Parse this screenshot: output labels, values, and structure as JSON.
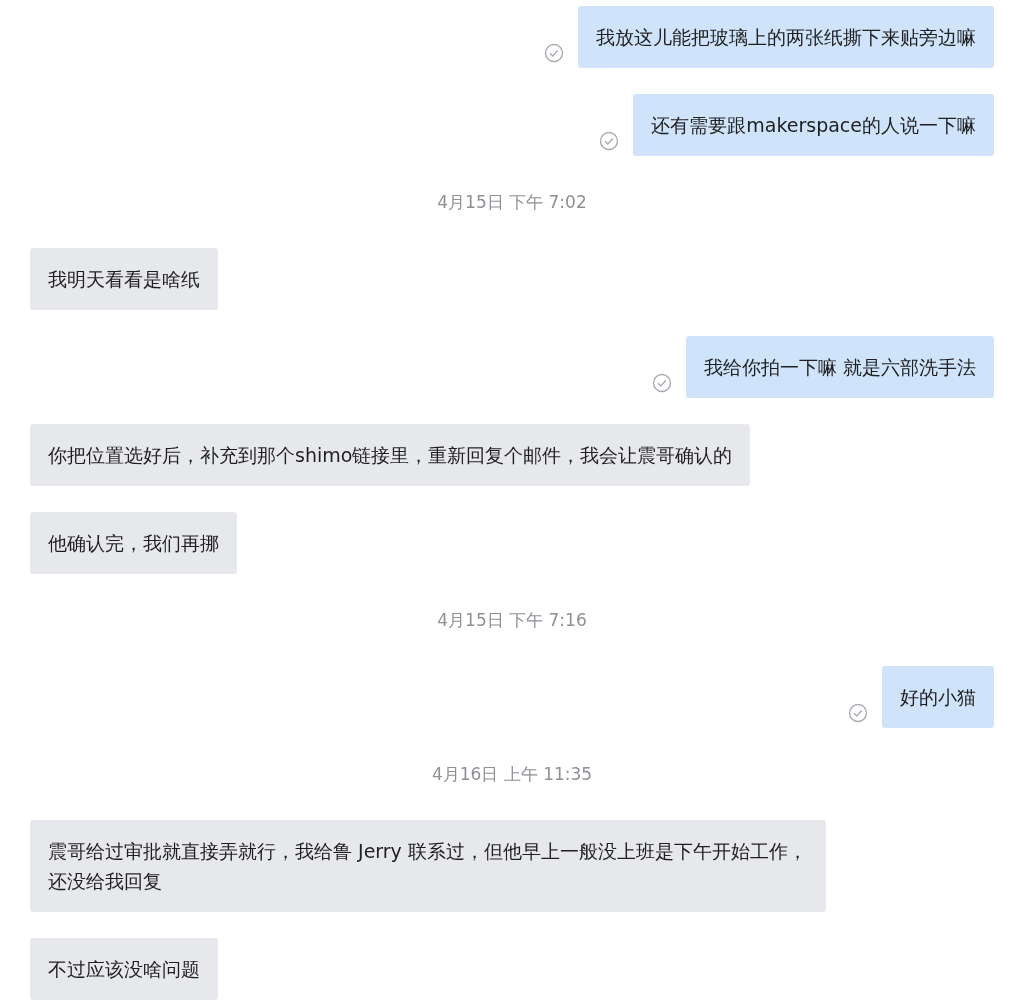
{
  "messages": [
    {
      "kind": "outgoing",
      "text": "我放这儿能把玻璃上的两张纸撕下来贴旁边嘛"
    },
    {
      "kind": "outgoing",
      "text": "还有需要跟makerspace的人说一下嘛"
    },
    {
      "kind": "time",
      "text": "4月15日 下午 7:02"
    },
    {
      "kind": "incoming",
      "text": "我明天看看是啥纸"
    },
    {
      "kind": "outgoing",
      "text": "我给你拍一下嘛 就是六部洗手法"
    },
    {
      "kind": "incoming",
      "text": "你把位置选好后，补充到那个shimo链接里，重新回复个邮件，我会让震哥确认的"
    },
    {
      "kind": "incoming",
      "text": "他确认完，我们再挪"
    },
    {
      "kind": "time",
      "text": "4月15日 下午 7:16"
    },
    {
      "kind": "outgoing",
      "text": "好的小猫"
    },
    {
      "kind": "time",
      "text": "4月16日 上午 11:35"
    },
    {
      "kind": "incoming",
      "text": "震哥给过审批就直接弄就行，我给鲁 Jerry 联系过，但他早上一般没上班是下午开始工作，还没给我回复"
    },
    {
      "kind": "incoming",
      "text": "不过应该没啥问题"
    }
  ]
}
